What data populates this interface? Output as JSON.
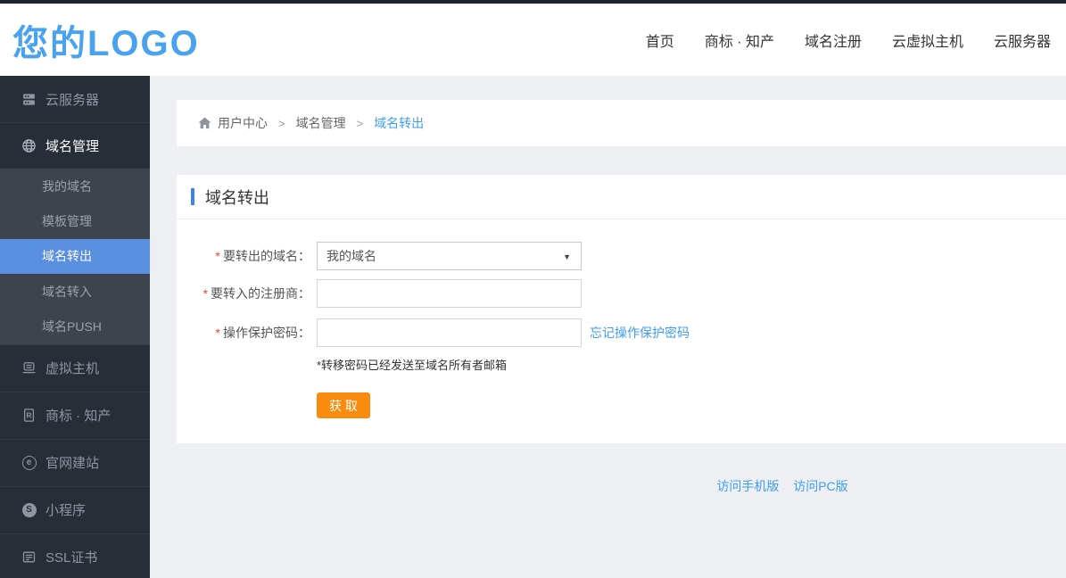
{
  "header": {
    "logo_text": "您的LOGO",
    "nav_items": [
      "首页",
      "商标 · 知产",
      "域名注册",
      "云虚拟主机",
      "云服务器"
    ]
  },
  "sidebar": {
    "items": [
      {
        "label": "云服务器"
      },
      {
        "label": "域名管理"
      },
      {
        "label": "虚拟主机"
      },
      {
        "label": "商标 · 知产"
      },
      {
        "label": "官网建站"
      },
      {
        "label": "小程序"
      },
      {
        "label": "SSL证书"
      }
    ],
    "domain_submenu": {
      "items": [
        {
          "label": "我的域名"
        },
        {
          "label": "模板管理"
        },
        {
          "label": "域名转出"
        },
        {
          "label": "域名转入"
        },
        {
          "label": "域名PUSH"
        }
      ],
      "active_item": "域名转出"
    }
  },
  "breadcrumb": {
    "items": [
      "用户中心",
      "域名管理",
      "域名转出"
    ],
    "separator": ">"
  },
  "card": {
    "title": "域名转出",
    "form": {
      "rows": [
        {
          "required": "*",
          "label": "要转出的域名：",
          "type": "select",
          "value": "我的域名"
        },
        {
          "required": "*",
          "label": "要转入的注册商：",
          "type": "input",
          "value": "",
          "placeholder": ""
        },
        {
          "required": "*",
          "label": "操作保护密码：",
          "type": "input",
          "value": "",
          "placeholder": "",
          "link": "忘记操作保护密码"
        }
      ],
      "note": "*转移密码已经发送至域名所有者邮箱",
      "submit_label": "获 取"
    }
  },
  "footer": {
    "links": [
      "访问手机版",
      "访问PC版"
    ]
  },
  "colors": {
    "logo_blue": "#49a2ee",
    "sidebar_bg": "#272e38",
    "submenu_bg": "#3d444d",
    "active_item_blue": "#5a8ede",
    "link_blue": "#3f9df5",
    "accent_bar_blue": "#4285d8",
    "button_orange": "#f98c0e",
    "page_bg": "#edeff2"
  }
}
